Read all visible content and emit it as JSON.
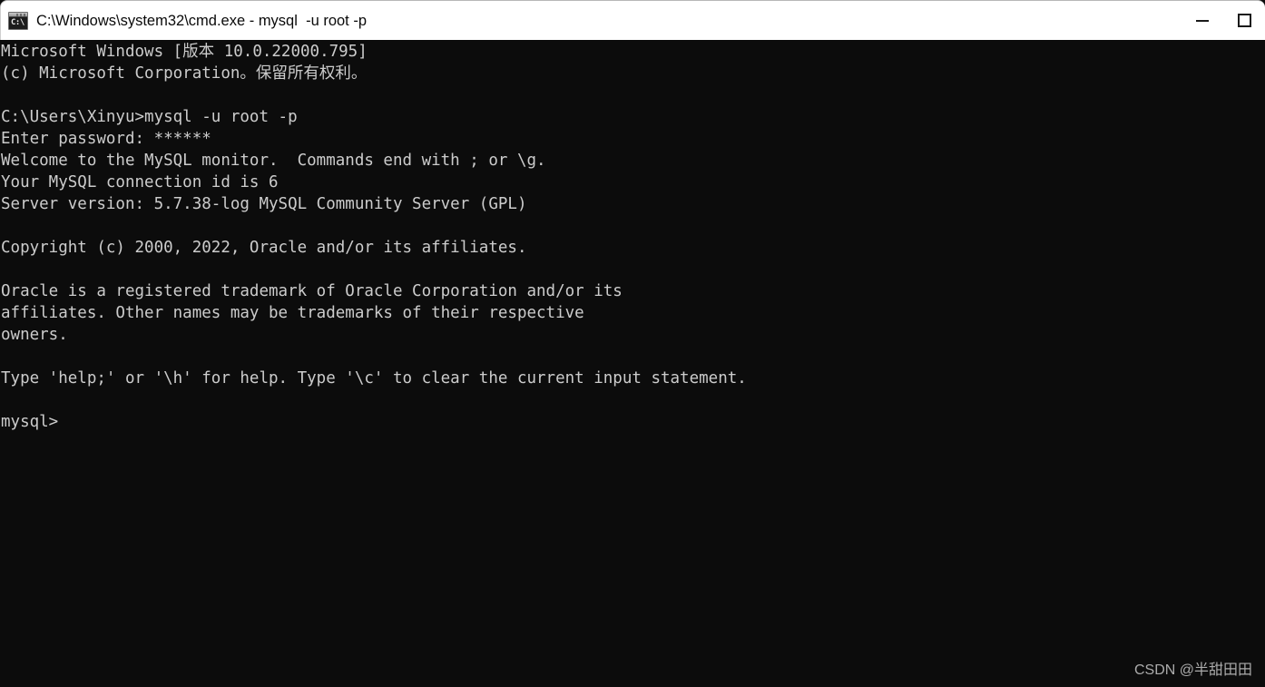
{
  "window": {
    "title": "C:\\Windows\\system32\\cmd.exe - mysql  -u root -p",
    "icon": "cmd-icon",
    "icon_glyph": "C:\\",
    "background_color": "#0c0c0c",
    "titlebar_color": "#ffffff",
    "text_color": "#cccccc"
  },
  "controls": {
    "minimize_label": "—",
    "maximize_label": "☐",
    "minimize_name": "minimize",
    "maximize_name": "maximize"
  },
  "console": {
    "lines": [
      "Microsoft Windows [版本 10.0.22000.795]",
      "(c) Microsoft Corporation。保留所有权利。",
      "",
      "C:\\Users\\Xinyu>mysql -u root -p",
      "Enter password: ******",
      "Welcome to the MySQL monitor.  Commands end with ; or \\g.",
      "Your MySQL connection id is 6",
      "Server version: 5.7.38-log MySQL Community Server (GPL)",
      "",
      "Copyright (c) 2000, 2022, Oracle and/or its affiliates.",
      "",
      "Oracle is a registered trademark of Oracle Corporation and/or its",
      "affiliates. Other names may be trademarks of their respective",
      "owners.",
      "",
      "Type 'help;' or '\\h' for help. Type '\\c' to clear the current input statement.",
      "",
      "mysql>"
    ],
    "text": "Microsoft Windows [版本 10.0.22000.795]\n(c) Microsoft Corporation。保留所有权利。\n\nC:\\Users\\Xinyu>mysql -u root -p\nEnter password: ******\nWelcome to the MySQL monitor.  Commands end with ; or \\g.\nYour MySQL connection id is 6\nServer version: 5.7.38-log MySQL Community Server (GPL)\n\nCopyright (c) 2000, 2022, Oracle and/or its affiliates.\n\nOracle is a registered trademark of Oracle Corporation and/or its\naffiliates. Other names may be trademarks of their respective\nowners.\n\nType 'help;' or '\\h' for help. Type '\\c' to clear the current input statement.\n\nmysql>",
    "prompt": "mysql>",
    "command_entered": "mysql -u root -p",
    "password_masked": "******",
    "connection_id": "6",
    "server_version": "5.7.38-log MySQL Community Server (GPL)",
    "os_version": "10.0.22000.795"
  },
  "watermark": {
    "text": "CSDN @半甜田田"
  }
}
